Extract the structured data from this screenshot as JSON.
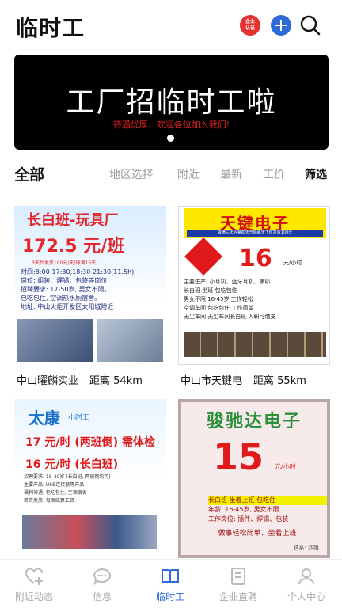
{
  "header": {
    "title": "临时工",
    "badge_line1": "企业",
    "badge_line2": "认证"
  },
  "banner": {
    "title": "工厂招临时工啦",
    "subtitle": "待遇优厚，欢迎各位加入我们!"
  },
  "filters": {
    "all": "全部",
    "items": [
      "地区选择",
      "附近",
      "最新",
      "工价"
    ],
    "screen": "筛选"
  },
  "cards": [
    {
      "company": "中山曜麟实业",
      "distance": "距离 54km",
      "poster": {
        "title": "长白班-玩具厂",
        "wage": "172.5 元/班",
        "note": "3天后发放100元/天(做满15天)",
        "lines": [
          "时间:8:00-17:30,18:30-21:30(11.5h)",
          "岗位: 组装、焊锡、包装等岗位",
          "招聘要求: 17-50岁, 男女不限。",
          "包吃包住, 空调热水厕宿舍。",
          "地址: 中山火炬开发区太阳城附近"
        ]
      }
    },
    {
      "company": "中山市天键电",
      "distance": "距离 55km",
      "poster": {
        "title": "天键电子",
        "subtitle": "做满三天后第四天开始每天下班发放100元",
        "wage": "16",
        "unit": "元/小时",
        "lines": [
          "主要生产: 小耳机、蓝牙耳机、喇叭",
          "长白班  坐班  包吃包住",
          "男女不限  16-45岁  工作轻松",
          "空调车间  包吃包住  工作简单",
          "无尘车间  无尘车间长白班  入职可借支"
        ]
      }
    },
    {
      "company": "",
      "distance": "",
      "poster": {
        "title": "太康",
        "title_small": "小时工",
        "line1": "17 元/时 (两班倒) 需体检",
        "line2": "16 元/时 (长白班)",
        "lines": [
          "招聘要求: 18-40岁 (长白班, 两班倒均可)",
          "主要产品: USB连接器等产品",
          "福利待遇: 包吃包住, 空调宿舍",
          "薪资发放: 每周结算工资"
        ]
      }
    },
    {
      "company": "",
      "distance": "",
      "poster": {
        "title": "骏驰达电子",
        "wage": "15",
        "unit": "元/小时",
        "lines": [
          "长白班  坐着上班  包吃住",
          "年龄: 16-45岁, 男女不限",
          "工作岗位: 插件、焊锡、包装"
        ],
        "footer": "做事轻松简单、坐着上班",
        "sign": "联系: 沙姐"
      }
    }
  ],
  "bottom_nav": [
    {
      "label": "附近动态",
      "icon": "heart-plus-icon",
      "active": false
    },
    {
      "label": "信息",
      "icon": "chat-bubble-icon",
      "active": false
    },
    {
      "label": "临时工",
      "icon": "book-icon",
      "active": true
    },
    {
      "label": "企业直聘",
      "icon": "document-icon",
      "active": false
    },
    {
      "label": "个人中心",
      "icon": "person-icon",
      "active": false
    }
  ],
  "colors": {
    "accent": "#2f6ad9",
    "badge_red": "#e3312d",
    "banner_bg": "#000000",
    "muted": "#9a9a9a"
  }
}
